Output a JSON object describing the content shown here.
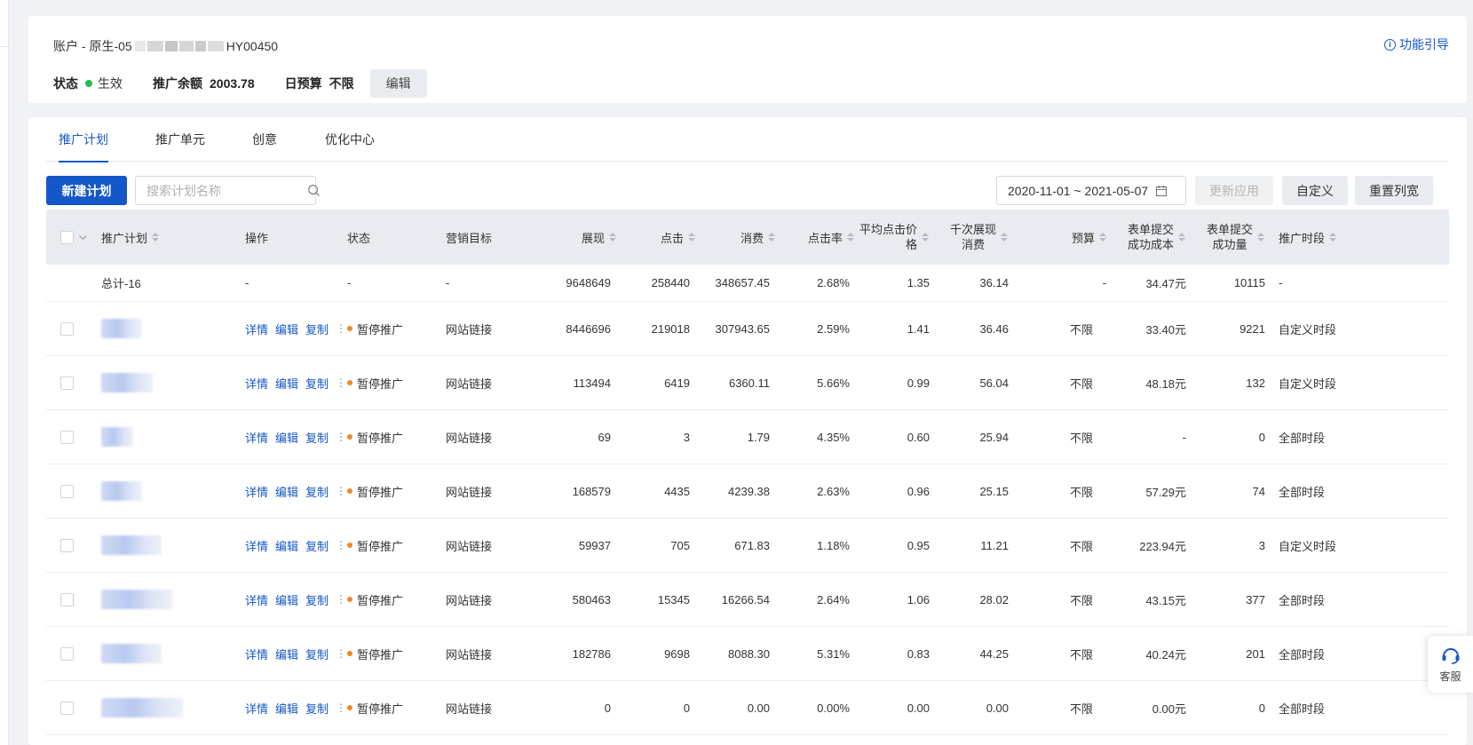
{
  "account": {
    "title_prefix": "账户 - 原生-05",
    "title_suffix": "HY00450",
    "status_label": "状态",
    "status_value": "生效",
    "balance_label": "推广余额",
    "balance_value": "2003.78",
    "budget_label": "日预算",
    "budget_value": "不限",
    "edit_label": "编辑",
    "guide_label": "功能引导"
  },
  "tabs": [
    {
      "label": "推广计划",
      "active": true
    },
    {
      "label": "推广单元",
      "active": false
    },
    {
      "label": "创意",
      "active": false
    },
    {
      "label": "优化中心",
      "active": false
    }
  ],
  "toolbar": {
    "new_plan": "新建计划",
    "search_placeholder": "搜索计划名称",
    "date_range": "2020-11-01 ~ 2021-05-07",
    "update_apply": "更新应用",
    "customize": "自定义",
    "reset_width": "重置列宽"
  },
  "columns": {
    "plan": "推广计划",
    "op": "操作",
    "status": "状态",
    "goal": "营销目标",
    "imp": "展现",
    "click": "点击",
    "cost": "消费",
    "ctr": "点击率",
    "cpc_line1": "平均点击价",
    "cpc_line2": "格",
    "cpm_line1": "千次展现",
    "cpm_line2": "消费",
    "budget": "预算",
    "form_cost_line1": "表单提交",
    "form_cost_line2": "成功成本",
    "form_count_line1": "表单提交",
    "form_count_line2": "成功量",
    "period": "推广时段"
  },
  "total": {
    "name": "总计-16",
    "op": "-",
    "status": "-",
    "goal": "-",
    "imp": "9648649",
    "click": "258440",
    "cost": "348657.45",
    "ctr": "2.68%",
    "cpc": "1.35",
    "cpm": "36.14",
    "budget": "-",
    "form_cost": "34.47元",
    "form_count": "10115",
    "period": "-"
  },
  "actions": {
    "detail": "详情",
    "edit": "编辑",
    "copy": "复制",
    "more": "⋮"
  },
  "rows": [
    {
      "status": "暂停推广",
      "goal": "网站链接",
      "imp": "8446696",
      "click": "219018",
      "cost": "307943.65",
      "ctr": "2.59%",
      "cpc": "1.41",
      "cpm": "36.46",
      "budget": "不限",
      "form_cost": "33.40元",
      "form_count": "9221",
      "period": "自定义时段"
    },
    {
      "status": "暂停推广",
      "goal": "网站链接",
      "imp": "113494",
      "click": "6419",
      "cost": "6360.11",
      "ctr": "5.66%",
      "cpc": "0.99",
      "cpm": "56.04",
      "budget": "不限",
      "form_cost": "48.18元",
      "form_count": "132",
      "period": "自定义时段"
    },
    {
      "status": "暂停推广",
      "goal": "网站链接",
      "imp": "69",
      "click": "3",
      "cost": "1.79",
      "ctr": "4.35%",
      "cpc": "0.60",
      "cpm": "25.94",
      "budget": "不限",
      "form_cost": "-",
      "form_count": "0",
      "period": "全部时段"
    },
    {
      "status": "暂停推广",
      "goal": "网站链接",
      "imp": "168579",
      "click": "4435",
      "cost": "4239.38",
      "ctr": "2.63%",
      "cpc": "0.96",
      "cpm": "25.15",
      "budget": "不限",
      "form_cost": "57.29元",
      "form_count": "74",
      "period": "全部时段"
    },
    {
      "status": "暂停推广",
      "goal": "网站链接",
      "imp": "59937",
      "click": "705",
      "cost": "671.83",
      "ctr": "1.18%",
      "cpc": "0.95",
      "cpm": "11.21",
      "budget": "不限",
      "form_cost": "223.94元",
      "form_count": "3",
      "period": "自定义时段"
    },
    {
      "status": "暂停推广",
      "goal": "网站链接",
      "imp": "580463",
      "click": "15345",
      "cost": "16266.54",
      "ctr": "2.64%",
      "cpc": "1.06",
      "cpm": "28.02",
      "budget": "不限",
      "form_cost": "43.15元",
      "form_count": "377",
      "period": "全部时段"
    },
    {
      "status": "暂停推广",
      "goal": "网站链接",
      "imp": "182786",
      "click": "9698",
      "cost": "8088.30",
      "ctr": "5.31%",
      "cpc": "0.83",
      "cpm": "44.25",
      "budget": "不限",
      "form_cost": "40.24元",
      "form_count": "201",
      "period": "全部时段"
    },
    {
      "status": "暂停推广",
      "goal": "网站链接",
      "imp": "0",
      "click": "0",
      "cost": "0.00",
      "ctr": "0.00%",
      "cpc": "0.00",
      "cpm": "0.00",
      "budget": "不限",
      "form_cost": "0.00元",
      "form_count": "0",
      "period": "全部时段"
    }
  ],
  "service": {
    "label": "客服"
  },
  "colors": {
    "accent": "#1457c8",
    "active_status": "#1fbf4f",
    "paused_status": "#f5871f"
  }
}
